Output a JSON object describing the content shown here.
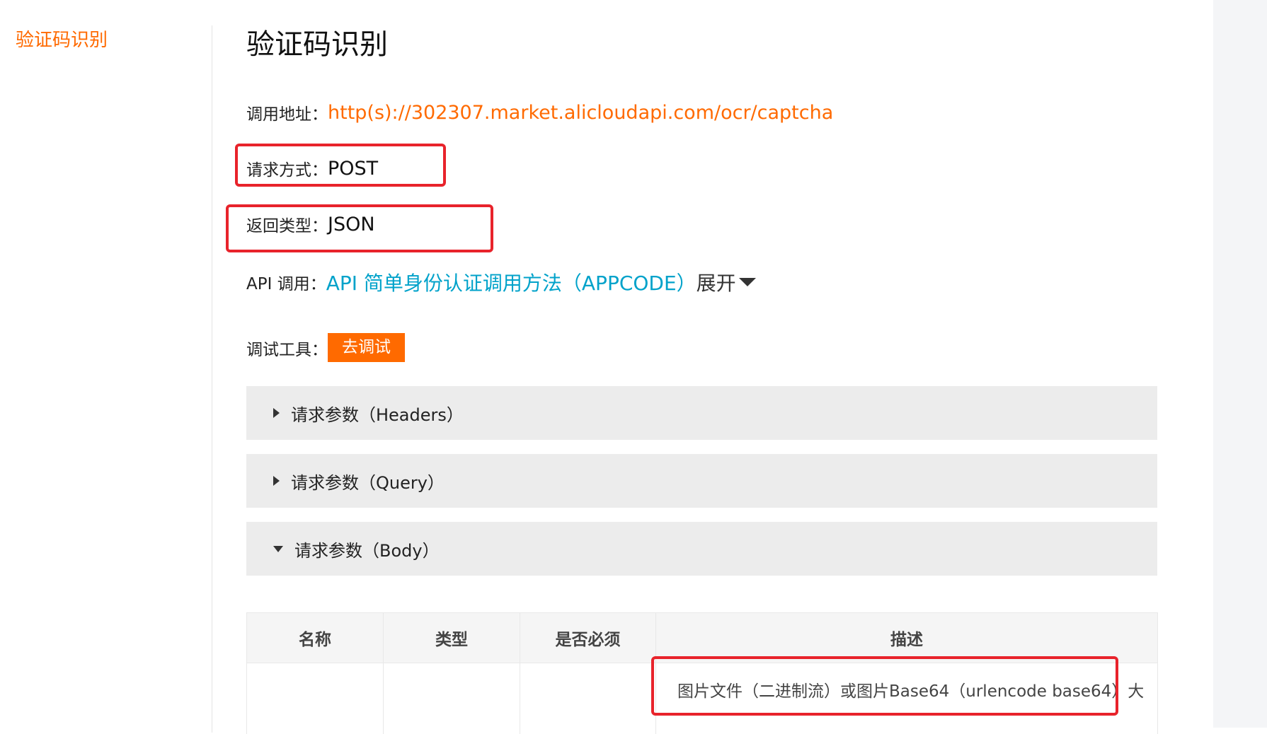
{
  "nav": {
    "current_item": "验证码识别"
  },
  "page": {
    "title": "验证码识别"
  },
  "info": {
    "url_label": "调用地址：",
    "url_value": "http(s)://302307.market.alicloudapi.com/ocr/captcha",
    "method_label": "请求方式：",
    "method_value": "POST",
    "return_label": "返回类型：",
    "return_value": "JSON",
    "api_label": "API 调用：",
    "api_link": "API 简单身份认证调用方法（APPCODE）",
    "expand_label": "展开",
    "debug_label": "调试工具：",
    "debug_button": "去调试"
  },
  "sections": [
    {
      "label": "请求参数（Headers）",
      "expanded": false
    },
    {
      "label": "请求参数（Query）",
      "expanded": false
    },
    {
      "label": "请求参数（Body）",
      "expanded": true
    }
  ],
  "table": {
    "headers": [
      "名称",
      "类型",
      "是否必须",
      "描述"
    ],
    "rows": [
      {
        "description": "图片文件（二进制流）或图片Base64（urlencode base64）大"
      }
    ]
  },
  "colors": {
    "accent": "#ff6a00",
    "link": "#00a2ca",
    "highlight": "#e8232b"
  }
}
